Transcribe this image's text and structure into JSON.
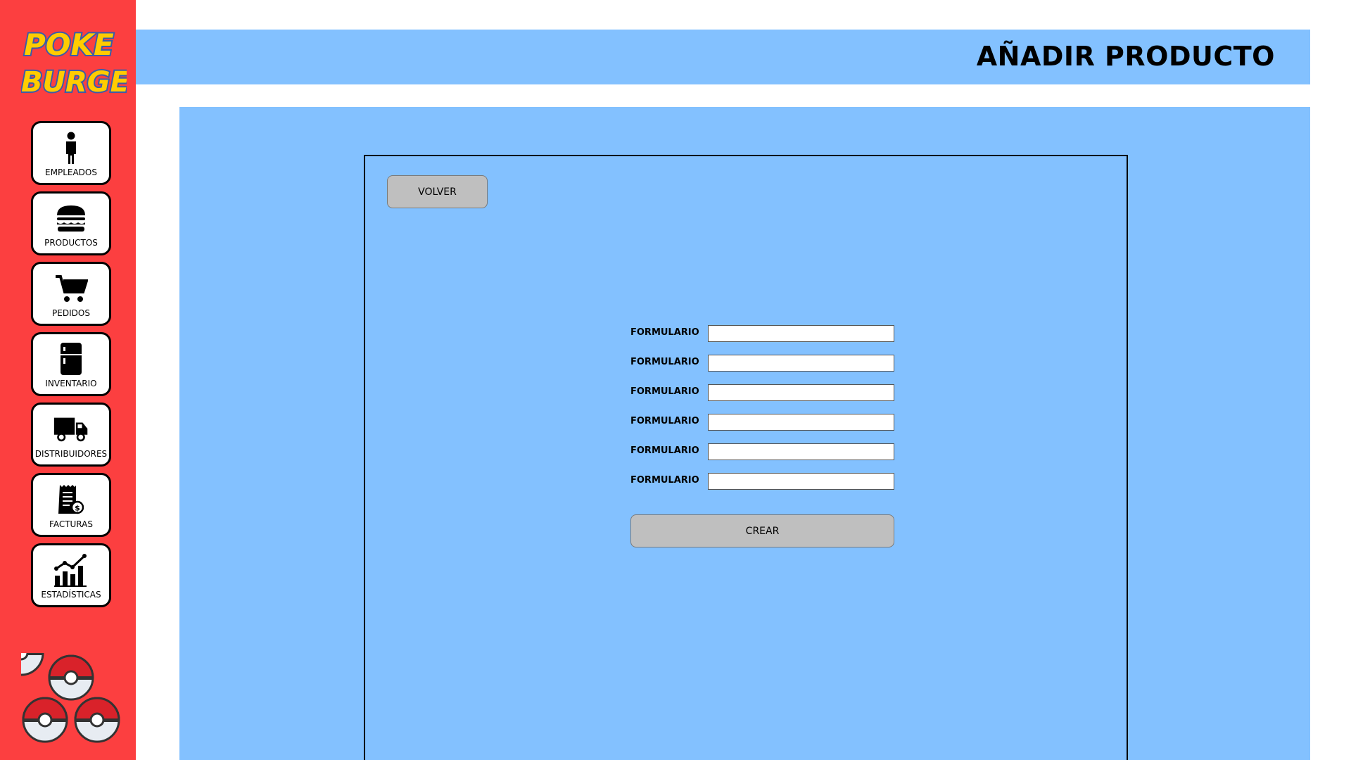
{
  "brand": {
    "logo_line1": "POKE",
    "logo_line2": "BURGER"
  },
  "colors": {
    "sidebar": "#fc3f40",
    "panel": "#83c1ff",
    "button": "#bfbfbf",
    "logo_yellow": "#ffcc00",
    "logo_blue": "#3b5ca8"
  },
  "sidebar": {
    "items": [
      {
        "label": "EMPLEADOS",
        "icon": "person-icon"
      },
      {
        "label": "PRODUCTOS",
        "icon": "burger-icon"
      },
      {
        "label": "PEDIDOS",
        "icon": "cart-icon"
      },
      {
        "label": "INVENTARIO",
        "icon": "fridge-icon"
      },
      {
        "label": "DISTRIBUIDORES",
        "icon": "truck-icon"
      },
      {
        "label": "FACTURAS",
        "icon": "invoice-icon"
      },
      {
        "label": "ESTADÍSTICAS",
        "icon": "stats-chart-icon"
      }
    ]
  },
  "header": {
    "title": "AÑADIR PRODUCTO"
  },
  "main": {
    "back_button": "VOLVER",
    "form": {
      "fields": [
        {
          "label": "FORMULARIO",
          "value": ""
        },
        {
          "label": "FORMULARIO",
          "value": ""
        },
        {
          "label": "FORMULARIO",
          "value": ""
        },
        {
          "label": "FORMULARIO",
          "value": ""
        },
        {
          "label": "FORMULARIO",
          "value": ""
        },
        {
          "label": "FORMULARIO",
          "value": ""
        }
      ],
      "submit_label": "CREAR"
    }
  }
}
